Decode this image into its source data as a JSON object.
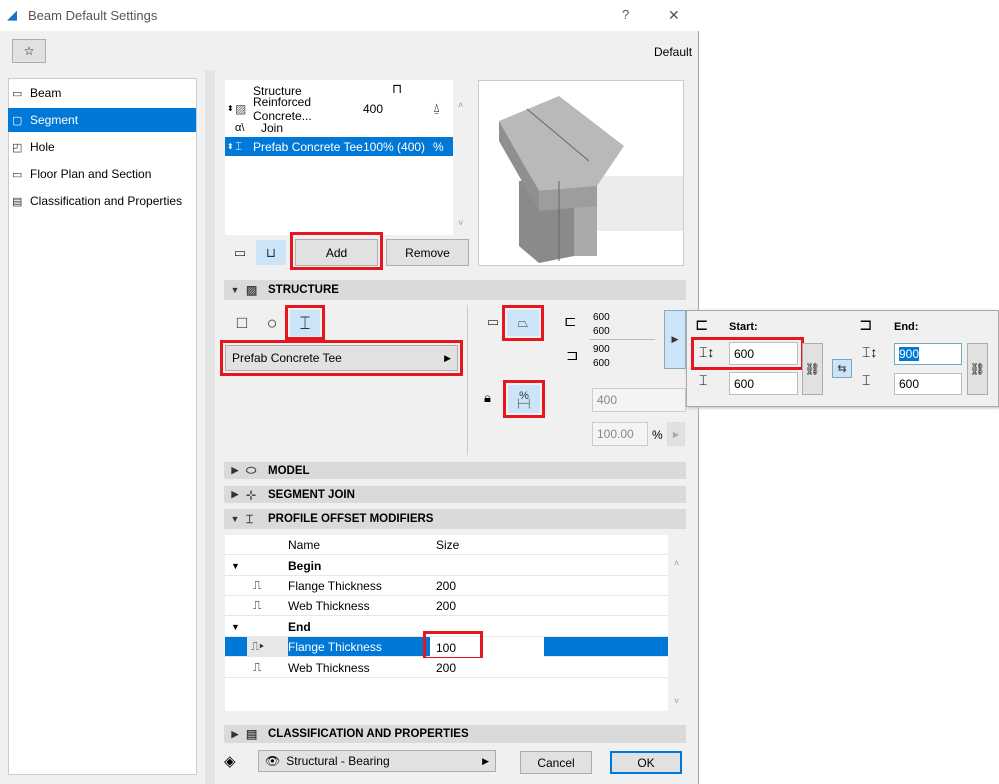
{
  "window": {
    "title": "Beam Default Settings",
    "help": "?",
    "close": "✕",
    "default_label": "Default"
  },
  "colors": {
    "accent": "#0078d7",
    "highlight": "#e5161e",
    "selected_icon_bg": "#cce4f7"
  },
  "sidebar": {
    "items": [
      {
        "label": "Beam",
        "icon": "beam-icon"
      },
      {
        "label": "Segment",
        "icon": "segment-icon",
        "selected": true
      },
      {
        "label": "Hole",
        "icon": "hole-icon"
      },
      {
        "label": "Floor Plan and Section",
        "icon": "floor-plan-icon"
      },
      {
        "label": "Classification and Properties",
        "icon": "classification-icon"
      }
    ]
  },
  "segments": {
    "header": "Structure",
    "rows": [
      {
        "name": "Reinforced Concrete...",
        "value": "400"
      },
      {
        "name": "Join"
      },
      {
        "name": "Prefab Concrete Tee",
        "value": "100% (400)",
        "selected": true
      }
    ],
    "add": "Add",
    "remove": "Remove"
  },
  "structure": {
    "title": "STRUCTURE",
    "profile": "Prefab Concrete Tee",
    "start_vals": [
      "600",
      "600"
    ],
    "end_vals": [
      "900",
      "600"
    ],
    "width": "400",
    "percent": "100.00",
    "percent_unit": "%",
    "pct_icon": "%"
  },
  "popup": {
    "start_label": "Start:",
    "end_label": "End:",
    "start_height": "600",
    "start_width": "600",
    "end_height": "900",
    "end_width": "600"
  },
  "sections": {
    "model": "MODEL",
    "segment_join": "SEGMENT JOIN",
    "profile_offset": "PROFILE OFFSET MODIFIERS",
    "classification": "CLASSIFICATION AND PROPERTIES"
  },
  "modifiers": {
    "col_name": "Name",
    "col_size": "Size",
    "groups": [
      {
        "label": "Begin",
        "rows": [
          {
            "name": "Flange Thickness",
            "size": "200"
          },
          {
            "name": "Web Thickness",
            "size": "200"
          }
        ]
      },
      {
        "label": "End",
        "rows": [
          {
            "name": "Flange Thickness",
            "size": "100",
            "selected": true
          },
          {
            "name": "Web Thickness",
            "size": "200"
          }
        ]
      }
    ]
  },
  "footer": {
    "layer": "Structural - Bearing",
    "cancel": "Cancel",
    "ok": "OK"
  }
}
